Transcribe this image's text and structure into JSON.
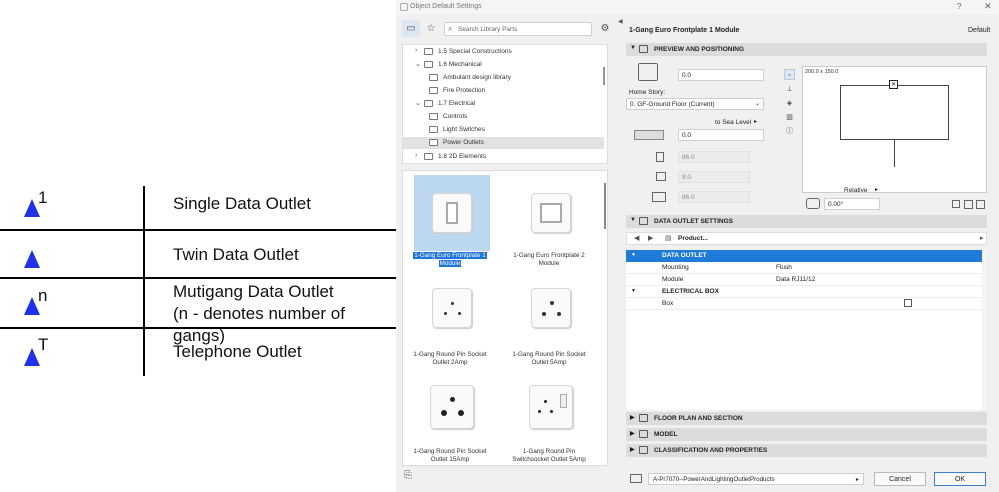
{
  "legend": {
    "rows": [
      {
        "sup": "1",
        "text": "Single Data Outlet"
      },
      {
        "sup": "",
        "text": "Twin Data Outlet"
      },
      {
        "sup": "n",
        "text": "Mutigang Data Outlet",
        "text2": "(n - denotes number of gangs)"
      },
      {
        "sup": "T",
        "text": "Telephone Outlet"
      }
    ],
    "symbol_color": "#1f32e8"
  },
  "dialog": {
    "title": "Object Default Settings",
    "help": "?",
    "close": "✕",
    "search_placeholder": "Search Library Parts",
    "tree": [
      {
        "label": "1.5 Special Constructions",
        "chev": "›"
      },
      {
        "label": "1.6 Mechanical",
        "chev": "⌄"
      },
      {
        "label": "Ambulant design library",
        "chev": ""
      },
      {
        "label": "Fire Protection",
        "chev": ""
      },
      {
        "label": "1.7 Electrical",
        "chev": "⌄"
      },
      {
        "label": "Controls",
        "chev": ""
      },
      {
        "label": "Light Switches",
        "chev": ""
      },
      {
        "label": "Power Outlets",
        "chev": ""
      },
      {
        "label": "1.8 2D Elements",
        "chev": "›"
      }
    ],
    "gallery": [
      {
        "label1": "1-Gang Euro Frontplate 1",
        "label2": "Module"
      },
      {
        "label1": "1-Gang Euro Frontplate 2",
        "label2": "Module"
      },
      {
        "label1": "1-Gang Round Pin Socket",
        "label2": "Outlet 2Amp"
      },
      {
        "label1": "1-Gang Round Pin Socket",
        "label2": "Outlet 5Amp"
      },
      {
        "label1": "1-Gang Round Pin Socket",
        "label2": "Outlet 15Amp"
      },
      {
        "label1": "1-Gang Round Pin",
        "label2": "Switchsocket Outlet 5Amp"
      }
    ],
    "right": {
      "object_name": "1-Gang Euro Frontplate 1 Module",
      "default_label": "Default",
      "preview_section": "PREVIEW AND POSITIONING",
      "elevation_value": "0.0",
      "home_story_label": "Home Story:",
      "home_story_value": "0. GF-Ground Floor (Current)",
      "to_sea_level": "to Sea Level",
      "sea_value": "0.0",
      "dim1": "86.0",
      "dim2": "9.0",
      "dim3": "86.0",
      "preview_dim": "200.0 x 150.0",
      "relative_label": "Relative",
      "angle_value": "0.00°",
      "data_section": "DATA OUTLET SETTINGS",
      "product_label": "Product...",
      "props": {
        "group1": "DATA OUTLET",
        "mounting_label": "Mounting",
        "mounting_value": "Flush",
        "module_label": "Module",
        "module_value": "Data RJ11/12",
        "group2": "ELECTRICAL BOX",
        "box_label": "Box"
      },
      "floor_plan": "FLOOR PLAN AND SECTION",
      "model": "MODEL",
      "classification": "CLASSIFICATION AND PROPERTIES",
      "footer_select": "A-Pr7070--PowerAndLightingOutletProducts",
      "cancel": "Cancel",
      "ok": "OK"
    }
  }
}
